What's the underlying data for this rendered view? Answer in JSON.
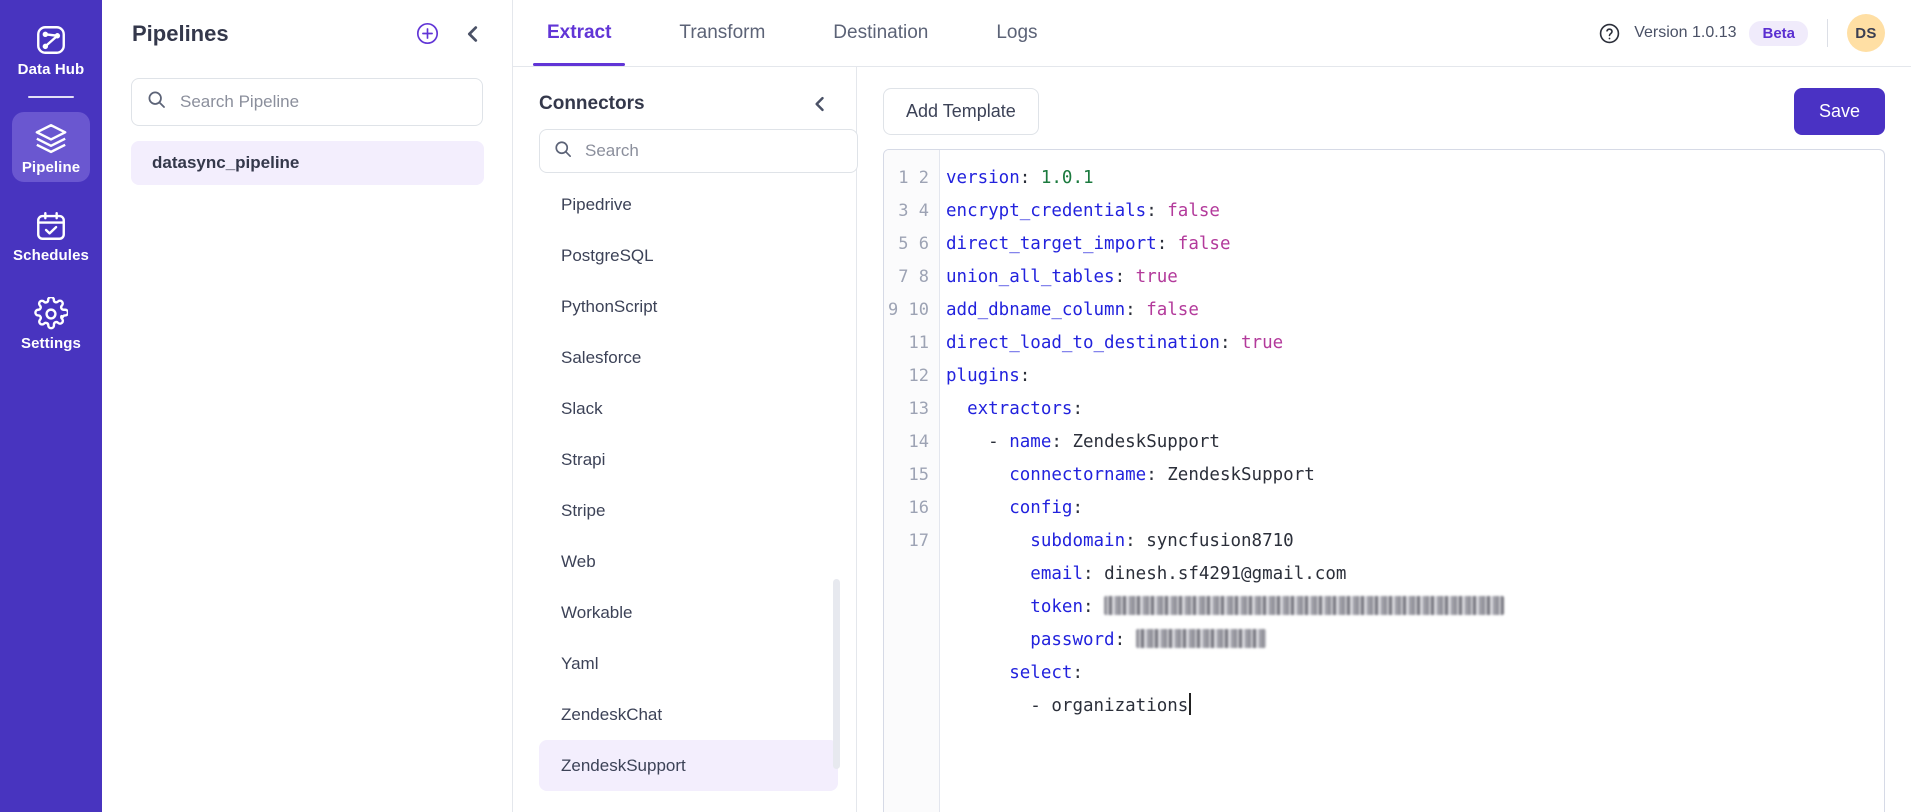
{
  "rail": {
    "items": [
      {
        "label": "Data Hub",
        "icon": "data-hub-icon",
        "active": false
      },
      {
        "label": "Pipeline",
        "icon": "layers-icon",
        "active": true
      },
      {
        "label": "Schedules",
        "icon": "calendar-check-icon",
        "active": false
      },
      {
        "label": "Settings",
        "icon": "gear-icon",
        "active": false
      }
    ]
  },
  "pipelines": {
    "title": "Pipelines",
    "add_icon": "plus-circle-icon",
    "collapse_icon": "chevron-left-icon",
    "search": {
      "value": "",
      "placeholder": "Search Pipeline",
      "icon": "search-icon"
    },
    "items": [
      {
        "label": "datasync_pipeline",
        "selected": true
      }
    ]
  },
  "header": {
    "tabs": [
      {
        "label": "Extract",
        "active": true
      },
      {
        "label": "Transform",
        "active": false
      },
      {
        "label": "Destination",
        "active": false
      },
      {
        "label": "Logs",
        "active": false
      }
    ],
    "help_icon": "help-circle-icon",
    "version": "Version 1.0.13",
    "badge": "Beta",
    "avatar": "DS"
  },
  "connectors": {
    "title": "Connectors",
    "collapse_icon": "chevron-left-icon",
    "search": {
      "value": "",
      "placeholder": "Search",
      "icon": "search-icon"
    },
    "items": [
      {
        "label": "Pipedrive",
        "selected": false
      },
      {
        "label": "PostgreSQL",
        "selected": false
      },
      {
        "label": "PythonScript",
        "selected": false
      },
      {
        "label": "Salesforce",
        "selected": false
      },
      {
        "label": "Slack",
        "selected": false
      },
      {
        "label": "Strapi",
        "selected": false
      },
      {
        "label": "Stripe",
        "selected": false
      },
      {
        "label": "Web",
        "selected": false
      },
      {
        "label": "Workable",
        "selected": false
      },
      {
        "label": "Yaml",
        "selected": false
      },
      {
        "label": "ZendeskChat",
        "selected": false
      },
      {
        "label": "ZendeskSupport",
        "selected": true
      }
    ]
  },
  "editor": {
    "add_template_label": "Add Template",
    "save_label": "Save",
    "line_numbers": [
      "1",
      "2",
      "3",
      "4",
      "5",
      "6",
      "7",
      "8",
      "9",
      "10",
      "11",
      "12",
      "13",
      "14",
      "15",
      "16",
      "17"
    ],
    "code_lines": [
      {
        "n": 1,
        "indent": 0,
        "key": "version",
        "sep": ": ",
        "value": "1.0.1",
        "value_type": "num"
      },
      {
        "n": 2,
        "indent": 0,
        "key": "encrypt_credentials",
        "sep": ": ",
        "value": "false",
        "value_type": "bool"
      },
      {
        "n": 3,
        "indent": 0,
        "key": "direct_target_import",
        "sep": ": ",
        "value": "false",
        "value_type": "bool"
      },
      {
        "n": 4,
        "indent": 0,
        "key": "union_all_tables",
        "sep": ": ",
        "value": "true",
        "value_type": "bool"
      },
      {
        "n": 5,
        "indent": 0,
        "key": "add_dbname_column",
        "sep": ": ",
        "value": "false",
        "value_type": "bool"
      },
      {
        "n": 6,
        "indent": 0,
        "key": "direct_load_to_destination",
        "sep": ": ",
        "value": "true",
        "value_type": "bool"
      },
      {
        "n": 7,
        "indent": 0,
        "key": "plugins",
        "sep": ":",
        "value": "",
        "value_type": "none"
      },
      {
        "n": 8,
        "indent": 2,
        "key": "extractors",
        "sep": ":",
        "value": "",
        "value_type": "none"
      },
      {
        "n": 9,
        "indent": 4,
        "dash": true,
        "key": "name",
        "sep": ": ",
        "value": "ZendeskSupport",
        "value_type": "plain"
      },
      {
        "n": 10,
        "indent": 6,
        "key": "connectorname",
        "sep": ": ",
        "value": "ZendeskSupport",
        "value_type": "plain"
      },
      {
        "n": 11,
        "indent": 6,
        "key": "config",
        "sep": ":",
        "value": "",
        "value_type": "none"
      },
      {
        "n": 12,
        "indent": 8,
        "key": "subdomain",
        "sep": ": ",
        "value": "syncfusion8710",
        "value_type": "plain"
      },
      {
        "n": 13,
        "indent": 8,
        "key": "email",
        "sep": ": ",
        "value": "dinesh.sf4291@gmail.com",
        "value_type": "plain"
      },
      {
        "n": 14,
        "indent": 8,
        "key": "token",
        "sep": ": ",
        "value": "",
        "value_type": "redacted",
        "redact_width": 400
      },
      {
        "n": 15,
        "indent": 8,
        "key": "password",
        "sep": ": ",
        "value": "",
        "value_type": "redacted",
        "redact_width": 130
      },
      {
        "n": 16,
        "indent": 6,
        "key": "select",
        "sep": ":",
        "value": "",
        "value_type": "none"
      },
      {
        "n": 17,
        "indent": 8,
        "dash": true,
        "key": "",
        "sep": "",
        "value": "organizations",
        "value_type": "plain",
        "caret": true
      }
    ]
  },
  "colors": {
    "brand_purple": "#4834bf",
    "accent_purple": "#6135d6",
    "selected_bg": "#f3eefd",
    "avatar_bg": "#ffdfa4",
    "yaml_key": "#2222dd",
    "yaml_bool": "#b33a9b",
    "yaml_num": "#1b7a3e"
  }
}
